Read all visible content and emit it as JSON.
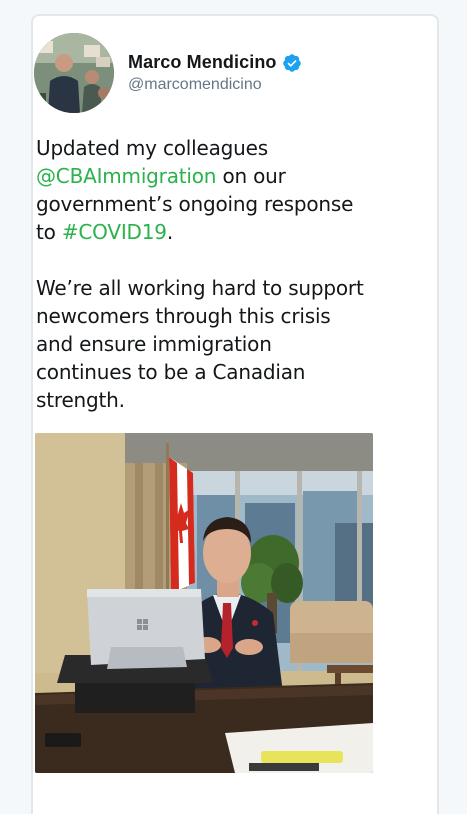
{
  "author": {
    "display_name": "Marco Mendicino",
    "handle": "@marcomendicino",
    "verified_icon": "verified-badge-icon",
    "verified_color": "#1da1f2"
  },
  "tweet": {
    "p1_part1": "Updated my colleagues",
    "mention": "@CBAImmigration",
    "p1_part2": "on our government’s ongoing response to",
    "hashtag": "#COVID19",
    "p1_end": ".",
    "p2": "We’re all working hard to support newcomers through this crisis and ensure immigration continues to be a Canadian strength."
  },
  "colors": {
    "link": "#2bb24c",
    "text": "#14171a",
    "muted": "#657786",
    "border": "#e1e8ed"
  },
  "media": {
    "icon": "photo"
  }
}
